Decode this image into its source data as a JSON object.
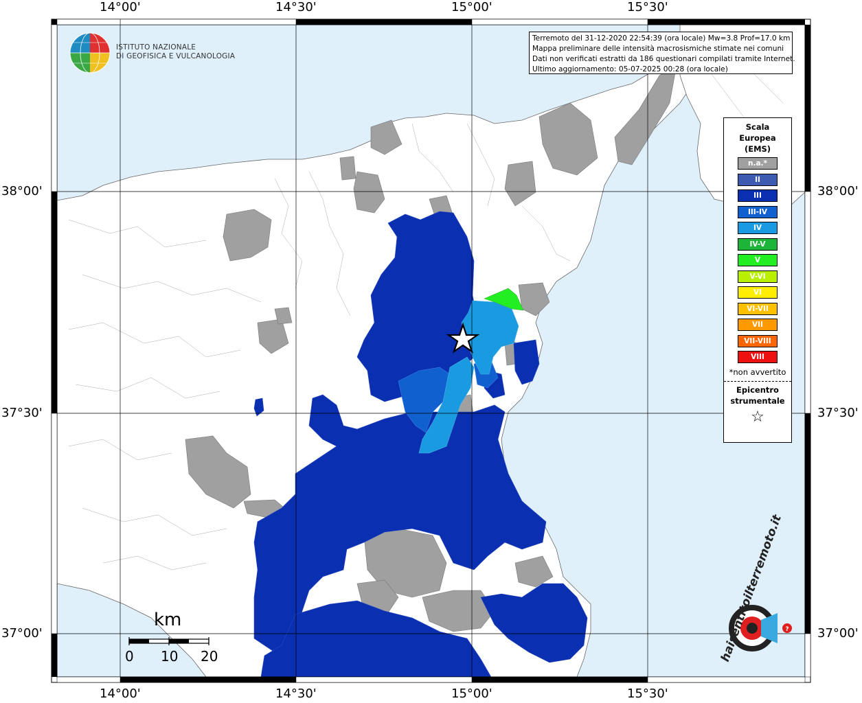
{
  "title_lines": [
    "Terremoto del 31-12-2020 22:54:39 (ora locale) Mw=3.8 Prof=17.0 km",
    "Mappa preliminare delle intensità macrosismiche stimate nei comuni",
    "Dati non verificati estratti da 186 questionari compilati tramite Internet.",
    "Ultimo aggiornamento: 05-07-2025 00:28 (ora locale)"
  ],
  "logo": {
    "line1": "ISTITUTO NAZIONALE",
    "line2": "DI GEOFISICA E VULCANOLOGIA"
  },
  "legend": {
    "title_lines": [
      "Scala",
      "Europea",
      "(EMS)"
    ],
    "items": [
      {
        "label": "n.a.*",
        "color": "#a0a0a0"
      },
      {
        "label": "II",
        "color": "#3d5bb0"
      },
      {
        "label": "III",
        "color": "#0a2fb0"
      },
      {
        "label": "III-IV",
        "color": "#1060d0"
      },
      {
        "label": "IV",
        "color": "#1a9ae0"
      },
      {
        "label": "IV-V",
        "color": "#1cb53a"
      },
      {
        "label": "V",
        "color": "#22ee22"
      },
      {
        "label": "V-VI",
        "color": "#b8f000"
      },
      {
        "label": "VI",
        "color": "#ffee00"
      },
      {
        "label": "VI-VII",
        "color": "#ffc000"
      },
      {
        "label": "VII",
        "color": "#ff9900"
      },
      {
        "label": "VII-VIII",
        "color": "#ff6600"
      },
      {
        "label": "VIII",
        "color": "#ee1111"
      }
    ],
    "note": "*non avvertito",
    "epicenter_lines": [
      "Epicentro",
      "strumentale"
    ],
    "star": "☆"
  },
  "axes": {
    "lon_labels": [
      "14°00'",
      "14°30'",
      "15°00'",
      "15°30'"
    ],
    "lat_labels": [
      "38°00'",
      "37°30'",
      "37°00'"
    ]
  },
  "scale_bar": {
    "unit": "km",
    "ticks": [
      "0",
      "10",
      "20"
    ]
  },
  "colors": {
    "sea": "#dff0fb",
    "land": "#ffffff",
    "na": "#a0a0a0",
    "ems_iii": "#0a2fb0",
    "ems_iii_iv": "#1060d0",
    "ems_iv": "#1a9ae0",
    "ems_v": "#22ee22"
  },
  "site_logo": "haisentitoilterremoto.it"
}
